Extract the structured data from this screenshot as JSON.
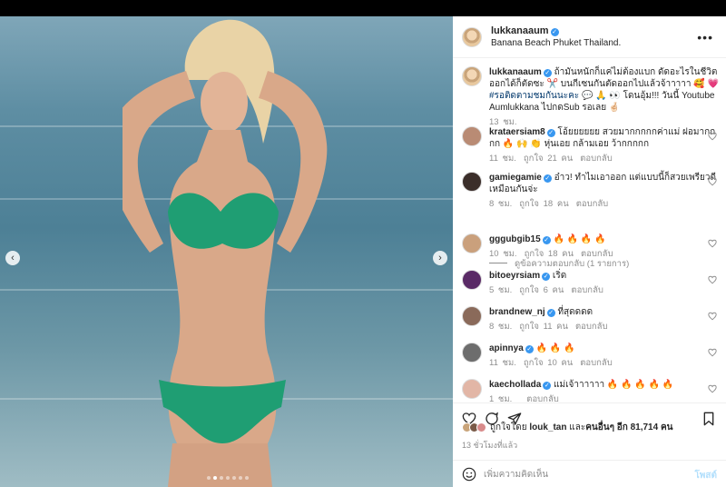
{
  "post": {
    "username": "lukkanaaum",
    "location": "Banana Beach Phuket Thailand.",
    "caption_user": "lukkanaaum",
    "caption_text": "ถ้ามันหนักก็แค่ไม่ต้องแบก ดัดอะไรในชีวิตออกได้ก็ตัดซะ ✂️ บนกีเซนกันตัดออกไปแล้วจ้าาาาา 🥰 💗",
    "caption_tag": "#รอติดตามชมกันนะคะ",
    "caption_tail": "💬 🙏 👀 โดนอุ้ม!!! วันนี้ Youtube Aumlukkana ไปกดSub รอเลย 🤞🏻",
    "caption_time": "13 ชม."
  },
  "comments": [
    {
      "user": "krataersiam8",
      "text": "โอ้ยยยยยย สวยมากกกกกค่าแม่ ฝอมากกกก 🔥 🙌 👏 หุ่นเอย กล้ามเอย ว้ากกกกก",
      "time": "11 ชม.",
      "likes": "ถูกใจ 21 คน",
      "reply": "ตอบกลับ"
    },
    {
      "user": "gamiegamie",
      "text": "อ๋าว! ทำไมเอาออก แต่แบบนี้ก็สวยเพรียวดีเหมือนกันจ่ะ",
      "time": "8 ชม.",
      "likes": "ถูกใจ 18 คน",
      "reply": "ตอบกลับ"
    },
    {
      "user": "gggubgib15",
      "text": "🔥 🔥 🔥 🔥",
      "time": "10 ชม.",
      "likes": "ถูกใจ 18 คน",
      "reply": "ตอบกลับ"
    },
    {
      "user": "bitoeyrsiam",
      "text": "เริ่ด",
      "time": "5 ชม.",
      "likes": "ถูกใจ 6 คน",
      "reply": "ตอบกลับ"
    },
    {
      "user": "brandnew_nj",
      "text": "ที่สุดดดด",
      "time": "8 ชม.",
      "likes": "ถูกใจ 11 คน",
      "reply": "ตอบกลับ"
    },
    {
      "user": "apinnya",
      "text": "🔥 🔥 🔥",
      "time": "11 ชม.",
      "likes": "ถูกใจ 10 คน",
      "reply": "ตอบกลับ"
    },
    {
      "user": "kaechollada",
      "text": "แม่เจ้าาาาาา 🔥 🔥 🔥 🔥 🔥",
      "time": "1 ชม.",
      "likes": "",
      "reply": "ตอบกลับ"
    }
  ],
  "view_replies": "ดูข้อความตอบกลับ (1 รายการ)",
  "liked_by": {
    "prefix": "ถูกใจโดย",
    "user": "louk_tan",
    "middle": "และ",
    "others": "คนอื่นๆ อีก 81,714 คน"
  },
  "post_time": "13 ชั่วโมงที่แล้ว",
  "add_comment": {
    "placeholder": "เพิ่มความคิดเห็น",
    "post_label": "โพสต์"
  },
  "colors": {
    "verified": "#3897f0",
    "link": "#00376b",
    "muted": "#8e8e8e",
    "bikini": "#1f9e73"
  },
  "carousel": {
    "slides": 7,
    "active": 1
  }
}
